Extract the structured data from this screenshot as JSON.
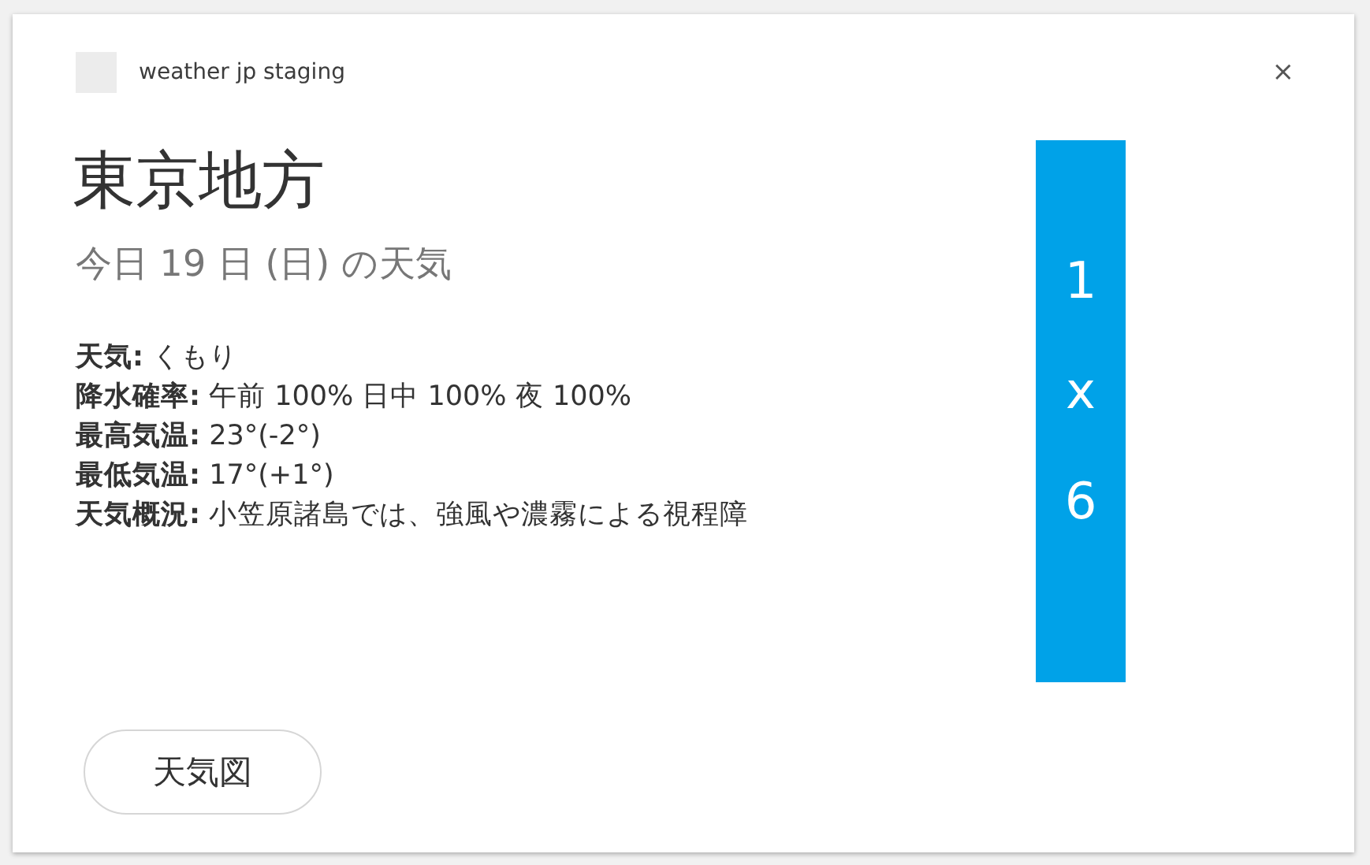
{
  "app": {
    "name": "weather jp staging",
    "close": "×"
  },
  "title": "東京地方",
  "subtitle": "今日 19 日 (日) の天気",
  "details": [
    "**天気:** くもり",
    "**降水確率:** 午前 100% 日中 100% 夜 100%",
    "**最高気温:** 23°(-2°)",
    "**最低気温:** 17°(+1°)",
    "**天気概況:** 小笠原諸島では、強風や濃霧による視程障"
  ],
  "ad_banner": {
    "lines": [
      "1",
      "x",
      "6"
    ]
  },
  "buttons": [
    "天気図"
  ]
}
